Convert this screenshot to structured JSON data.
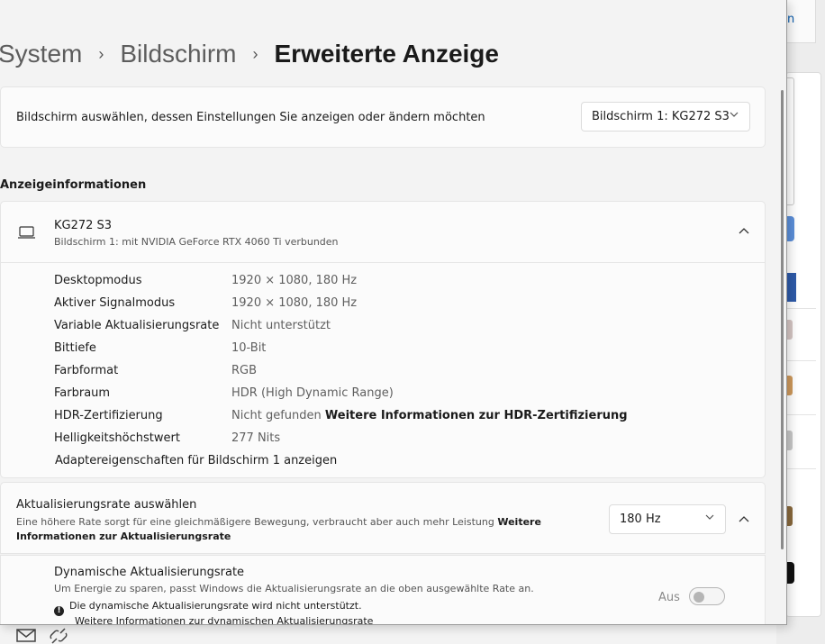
{
  "background": {
    "link_fragment": "n",
    "taskbar_icons": [
      "mail-icon",
      "link-icon"
    ]
  },
  "window": {
    "controls": [
      "restore-icon",
      "close-icon"
    ]
  },
  "breadcrumb": {
    "items": [
      "System",
      "Bildschirm"
    ],
    "current": "Erweiterte Anzeige",
    "separator": "›"
  },
  "select_display": {
    "label": "Bildschirm auswählen, dessen Einstellungen Sie anzeigen oder ändern möchten",
    "value": "Bildschirm 1: KG272 S3"
  },
  "display_info": {
    "section_title": "Anzeigeinformationen",
    "monitor_name": "KG272 S3",
    "monitor_sub": "Bildschirm 1: mit NVIDIA GeForce RTX 4060 Ti verbunden",
    "rows": [
      {
        "key": "Desktopmodus",
        "value": "1920 × 1080, 180 Hz"
      },
      {
        "key": "Aktiver Signalmodus",
        "value": "1920 × 1080, 180 Hz"
      },
      {
        "key": "Variable Aktualisierungsrate",
        "value": "Nicht unterstützt"
      },
      {
        "key": "Bittiefe",
        "value": "10-Bit"
      },
      {
        "key": "Farbformat",
        "value": "RGB"
      },
      {
        "key": "Farbraum",
        "value": "HDR (High Dynamic Range)"
      },
      {
        "key": "HDR-Zertifizierung",
        "value": "Nicht gefunden",
        "link": "Weitere Informationen zur HDR-Zertifizierung"
      },
      {
        "key": "Helligkeitshöchstwert",
        "value": "277 Nits"
      }
    ],
    "adapter_link": "Adaptereigenschaften für Bildschirm 1 anzeigen"
  },
  "refresh_rate": {
    "title": "Aktualisierungsrate auswählen",
    "desc": "Eine höhere Rate sorgt für eine gleichmäßigere Bewegung, verbraucht aber auch mehr Leistung ",
    "link": "Weitere Informationen zur Aktualisierungsrate",
    "value": "180 Hz"
  },
  "dynamic_rate": {
    "title": "Dynamische Aktualisierungsrate",
    "desc": "Um Energie zu sparen, passt Windows die Aktualisierungsrate an die oben ausgewählte Rate an.",
    "warning": "Die dynamische Aktualisierungsrate wird nicht unterstützt.",
    "more_link": "Weitere Informationen zur dynamischen Aktualisierungsrate",
    "toggle_state": "Aus",
    "toggle_on": false
  },
  "colors": {
    "accent": "#2e5aa8",
    "card_bg": "#fbfbfb",
    "window_bg": "#f3f3f3"
  }
}
